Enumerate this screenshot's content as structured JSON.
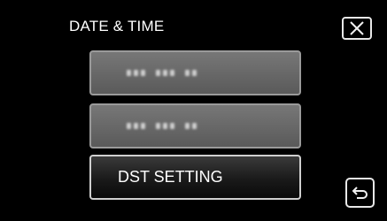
{
  "header": {
    "title": "DATE & TIME"
  },
  "buttons": {
    "close_icon": "close-icon",
    "back_icon": "back-arrow-icon"
  },
  "menu": {
    "items": [
      {
        "label": "",
        "state": "disabled-blurred"
      },
      {
        "label": "",
        "state": "disabled-blurred"
      },
      {
        "label": "DST SETTING",
        "state": "enabled"
      }
    ]
  },
  "colors": {
    "background": "#000000",
    "text": "#ffffff",
    "disabled_button": "#6a6a6a",
    "button_border": "#9a9a9a"
  }
}
